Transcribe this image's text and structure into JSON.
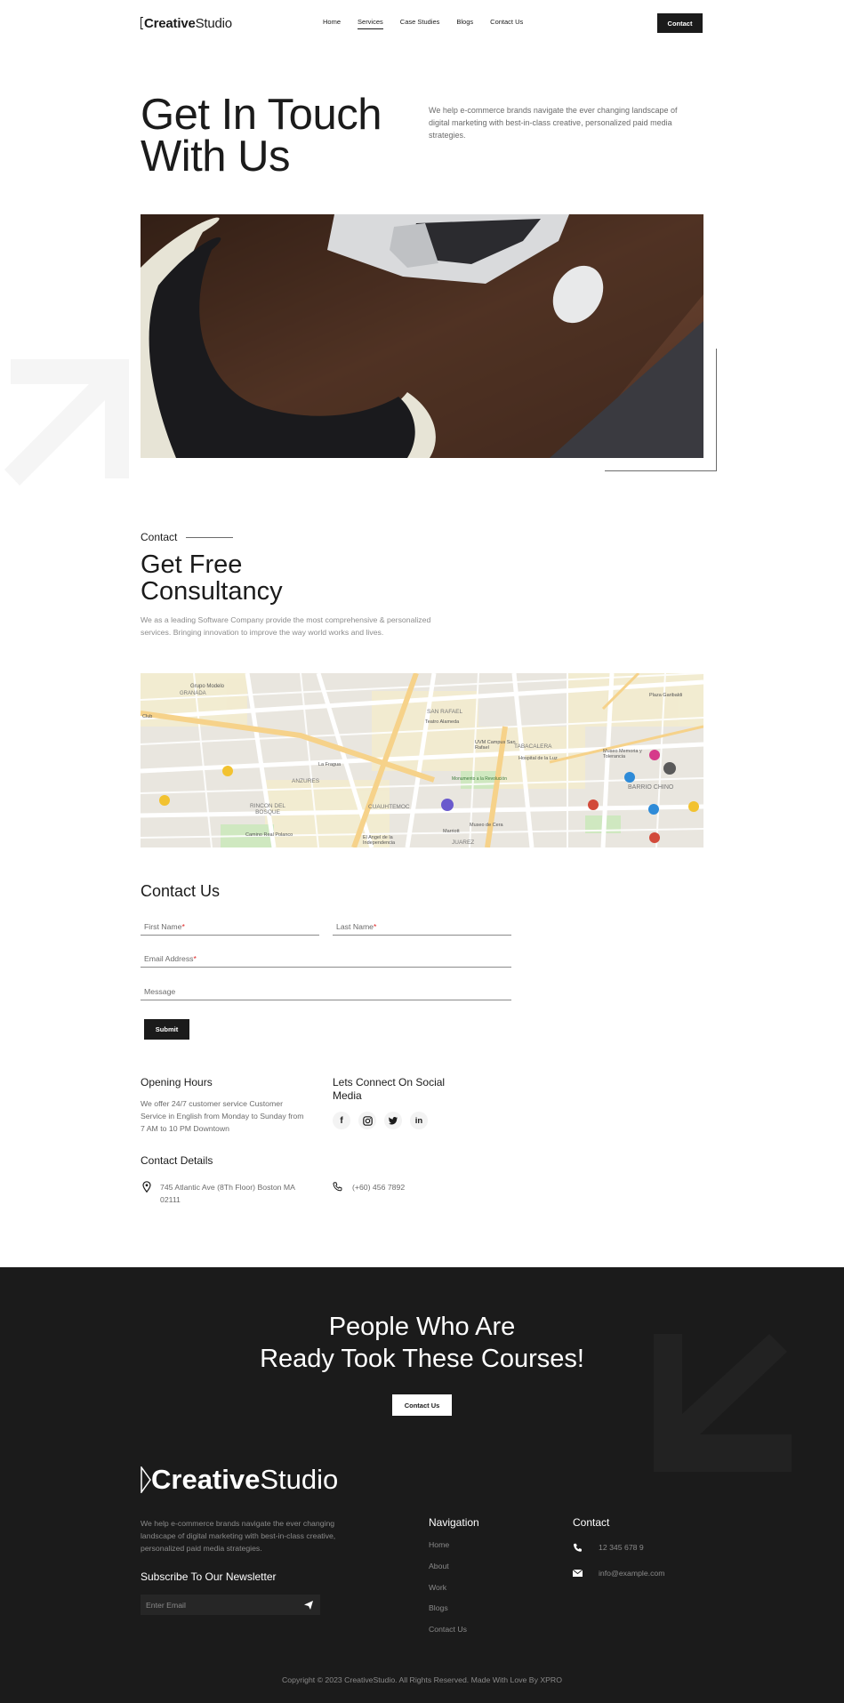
{
  "header": {
    "logo_bold": "Creative",
    "logo_light": "Studio",
    "nav": [
      "Home",
      "Services",
      "Case Studies",
      "Blogs",
      "Contact Us"
    ],
    "active_nav": "Services",
    "cta": "Contact"
  },
  "hero": {
    "title_line1": "Get In Touch",
    "title_line2": "With Us",
    "description": "We help e-commerce brands navigate the ever changing landscape of digital marketing with best-in-class creative, personalized paid media strategies."
  },
  "consultancy": {
    "eyebrow": "Contact",
    "title_line1": "Get Free",
    "title_line2": "Consultancy",
    "description": "We as a leading Software Company provide the most comprehensive & personalized services. Bringing innovation to improve the way world works and lives."
  },
  "map": {
    "labels": [
      "Grupo Modelo",
      "GRANADA",
      "SAN RAFAEL",
      "TABACALERA",
      "Teatro Alameda",
      "UVM Campus San Rafael",
      "Hospital de la Luz",
      "Museo Memoria y Tolerancia",
      "BARRIO CHINO",
      "Plaza Garibaldi",
      "ANZURES",
      "RINCON DEL BOSQUE",
      "CUAUHTEMOC",
      "Camino Real Polanco",
      "El Angel de la Independencia",
      "Museo de Cera",
      "JUAREZ",
      "Club",
      "La Fragua",
      "Monumento a la Revolución",
      "Marriott"
    ]
  },
  "contact_form": {
    "title": "Contact Us",
    "first_name": "First Name",
    "last_name": "Last Name",
    "email": "Email Address",
    "message": "Message",
    "required_mark": "*",
    "submit": "Submit"
  },
  "info": {
    "hours_title": "Opening Hours",
    "hours_text": "We offer 24/7 customer service Customer Service in English from Monday to Sunday from 7 AM to 10 PM Downtown",
    "social_title": "Lets Connect On Social Media",
    "social_icons": [
      "facebook-icon",
      "instagram-icon",
      "twitter-icon",
      "linkedin-icon"
    ],
    "details_title": "Contact Details",
    "address": "745 Atlantic Ave (8Th Floor) Boston MA 02111",
    "phone": "(+60) 456 7892"
  },
  "footer": {
    "cta_line1": "People Who Are",
    "cta_line2": "Ready Took These Courses!",
    "cta_button": "Contact Us",
    "logo_bold": "Creative",
    "logo_light": "Studio",
    "description": "We help e-commerce brands navigate the ever changing landscape of digital marketing with best-in-class creative, personalized paid media strategies.",
    "newsletter_title": "Subscribe To Our Newsletter",
    "newsletter_placeholder": "Enter Email",
    "nav_title": "Navigation",
    "nav_links": [
      "Home",
      "About",
      "Work",
      "Blogs",
      "Contact Us"
    ],
    "contact_title": "Contact",
    "contact_phone": "12 345 678 9",
    "contact_email": "info@example.com",
    "copyright": "Copyright © 2023 CreativeStudio. All Rights Reserved. Made With Love By XPRO"
  },
  "colors": {
    "dark": "#1b1b1b",
    "required": "#dd2222",
    "map_road": "#f6d28a"
  }
}
